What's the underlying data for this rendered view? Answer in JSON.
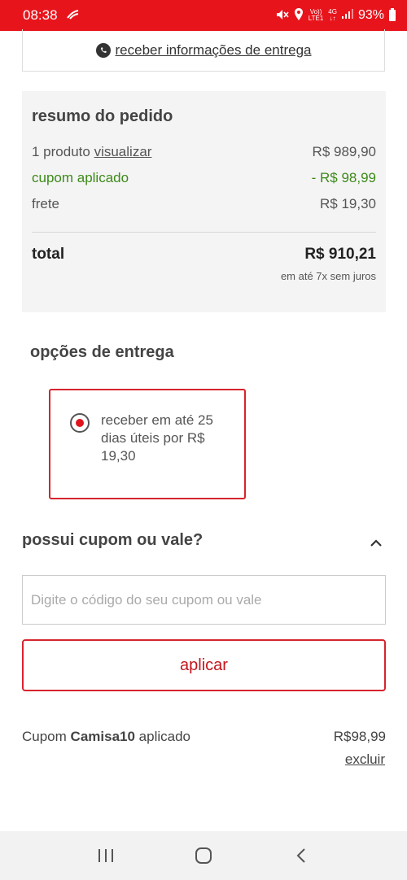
{
  "status_bar": {
    "time": "08:38",
    "network_top": "Vo))",
    "network_bottom": "LTE1",
    "network_type": "4G",
    "battery": "93%",
    "color": "#e8141c"
  },
  "whatsapp": {
    "link_text": "receber informações de entrega",
    "icon": "whatsapp-icon"
  },
  "summary": {
    "title": "resumo do pedido",
    "products_label": "1 produto",
    "view_link": "visualizar",
    "products_value": "R$ 989,90",
    "coupon_label": "cupom aplicado",
    "coupon_value": "- R$ 98,99",
    "shipping_label": "frete",
    "shipping_value": "R$ 19,30",
    "total_label": "total",
    "total_value": "R$ 910,21",
    "installments": "em até 7x sem juros"
  },
  "delivery": {
    "title": "opções de entrega",
    "option_text": "receber em até 25 dias úteis por R$ 19,30",
    "selected": true
  },
  "coupon": {
    "title": "possui cupom ou vale?",
    "placeholder": "Digite o código do seu cupom ou vale",
    "value": "",
    "apply_label": "aplicar",
    "applied_prefix": "Cupom",
    "applied_code": "Camisa10",
    "applied_suffix": "aplicado",
    "applied_value": "R$98,99",
    "remove_label": "excluir"
  },
  "colors": {
    "accent": "#d6242d",
    "discount": "#3d8a1a"
  }
}
